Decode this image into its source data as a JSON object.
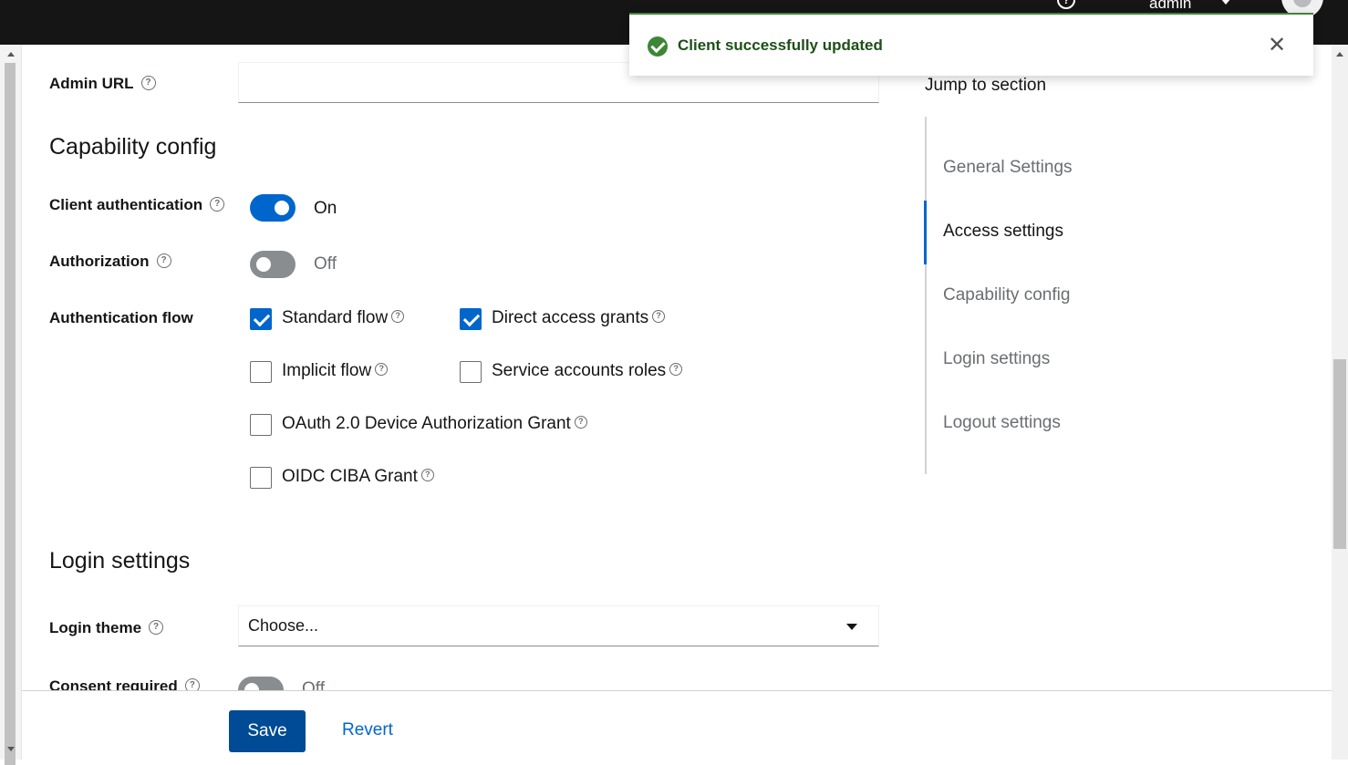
{
  "topbar": {
    "help_icon": "?",
    "user_name": "admin"
  },
  "toast": {
    "message": "Client successfully updated",
    "close": "✕"
  },
  "form": {
    "admin_url": {
      "label": "Admin URL",
      "value": ""
    },
    "capability_heading": "Capability config",
    "client_auth": {
      "label": "Client authentication",
      "state": "On"
    },
    "authorization": {
      "label": "Authorization",
      "state": "Off"
    },
    "auth_flow": {
      "label": "Authentication flow",
      "options": [
        {
          "label": "Standard flow",
          "checked": true
        },
        {
          "label": "Direct access grants",
          "checked": true
        },
        {
          "label": "Implicit flow",
          "checked": false
        },
        {
          "label": "Service accounts roles",
          "checked": false
        },
        {
          "label": "OAuth 2.0 Device Authorization Grant",
          "checked": false
        },
        {
          "label": "OIDC CIBA Grant",
          "checked": false
        }
      ]
    },
    "login_heading": "Login settings",
    "login_theme": {
      "label": "Login theme",
      "value": "Choose..."
    },
    "consent_required": {
      "label": "Consent required",
      "state": "Off"
    }
  },
  "jump": {
    "title": "Jump to section",
    "items": [
      "General Settings",
      "Access settings",
      "Capability config",
      "Login settings",
      "Logout settings"
    ],
    "active": "Access settings"
  },
  "footer": {
    "save": "Save",
    "revert": "Revert"
  },
  "help_glyph": "?",
  "colors": {
    "primary": "#0066cc",
    "success": "#3e8635",
    "save_button": "#004b95"
  }
}
